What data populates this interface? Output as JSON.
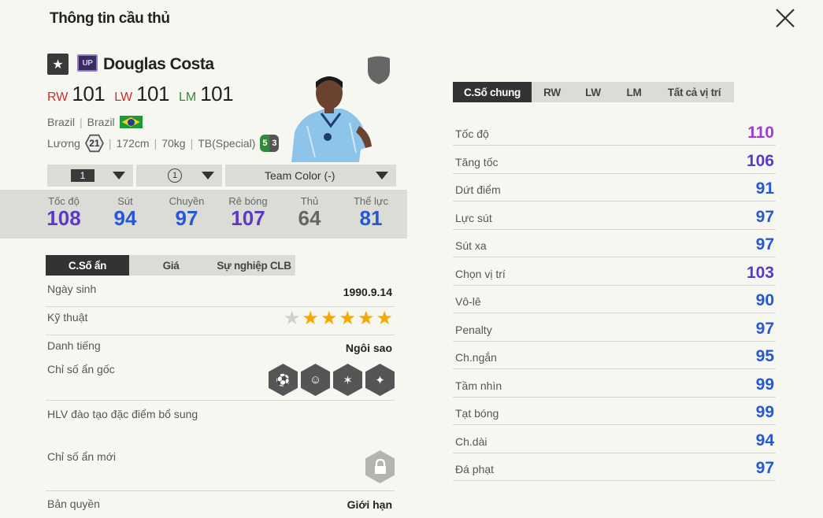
{
  "window": {
    "title": "Thông tin cầu thủ"
  },
  "player": {
    "season_badge": "UP",
    "name": "Douglas Costa",
    "positions": [
      {
        "label": "RW",
        "value": "101",
        "color": "#d42a2a"
      },
      {
        "label": "LW",
        "value": "101",
        "color": "#d42a2a"
      },
      {
        "label": "LM",
        "value": "101",
        "color": "#2e8b3a"
      }
    ],
    "nation": "Brazil",
    "national_team": "Brazil",
    "salary_label": "Lương",
    "salary": "21",
    "height": "172cm",
    "weight": "70kg",
    "body_type": "TB(Special)",
    "weak_foot_left": "5",
    "weak_foot_right": "3"
  },
  "selectors": {
    "level": "1",
    "grade": "1",
    "team_color": "Team Color (-)"
  },
  "key_stats": [
    {
      "label": "Tốc độ",
      "value": "108",
      "color": "#5a39c9"
    },
    {
      "label": "Sút",
      "value": "94",
      "color": "#2458d6"
    },
    {
      "label": "Chuyền",
      "value": "97",
      "color": "#2458d6"
    },
    {
      "label": "Rê bóng",
      "value": "107",
      "color": "#5a39c9"
    },
    {
      "label": "Thủ",
      "value": "64",
      "color": "#666666"
    },
    {
      "label": "Thể lực",
      "value": "81",
      "color": "#2458d6"
    }
  ],
  "left_tabs": [
    "C.Số ẩn",
    "Giá",
    "Sự nghiệp CLB"
  ],
  "details": {
    "birth_label": "Ngày sinh",
    "birth_value": "1990.9.14",
    "skill_label": "Kỹ thuật",
    "skill_stars": 5,
    "skill_stars_max": 6,
    "fame_label": "Danh tiếng",
    "fame_value": "Ngôi sao",
    "traits_label": "Chỉ số ẩn gốc",
    "coach_label": "HLV đào tạo đặc điểm bổ sung",
    "new_traits_label": "Chỉ số ẩn mới",
    "license_label": "Bản quyền",
    "license_value": "Giới hạn"
  },
  "right_tabs": [
    "C.Số chung",
    "RW",
    "LW",
    "LM",
    "Tất cả vị trí"
  ],
  "stats": [
    {
      "label": "Tốc độ",
      "value": "110",
      "color": "#9b3fd6"
    },
    {
      "label": "Tăng tốc",
      "value": "106",
      "color": "#5a39c9"
    },
    {
      "label": "Dứt điểm",
      "value": "91",
      "color": "#2458d6"
    },
    {
      "label": "Lực sút",
      "value": "97",
      "color": "#2458d6"
    },
    {
      "label": "Sút xa",
      "value": "97",
      "color": "#2458d6"
    },
    {
      "label": "Chọn vị trí",
      "value": "103",
      "color": "#5a39c9"
    },
    {
      "label": "Vô-lê",
      "value": "90",
      "color": "#2458d6"
    },
    {
      "label": "Penalty",
      "value": "97",
      "color": "#2458d6"
    },
    {
      "label": "Ch.ngắn",
      "value": "95",
      "color": "#2458d6"
    },
    {
      "label": "Tầm nhìn",
      "value": "99",
      "color": "#2458d6"
    },
    {
      "label": "Tạt bóng",
      "value": "99",
      "color": "#2458d6"
    },
    {
      "label": "Ch.dài",
      "value": "94",
      "color": "#2458d6"
    },
    {
      "label": "Đá phạt",
      "value": "97",
      "color": "#2458d6"
    }
  ]
}
